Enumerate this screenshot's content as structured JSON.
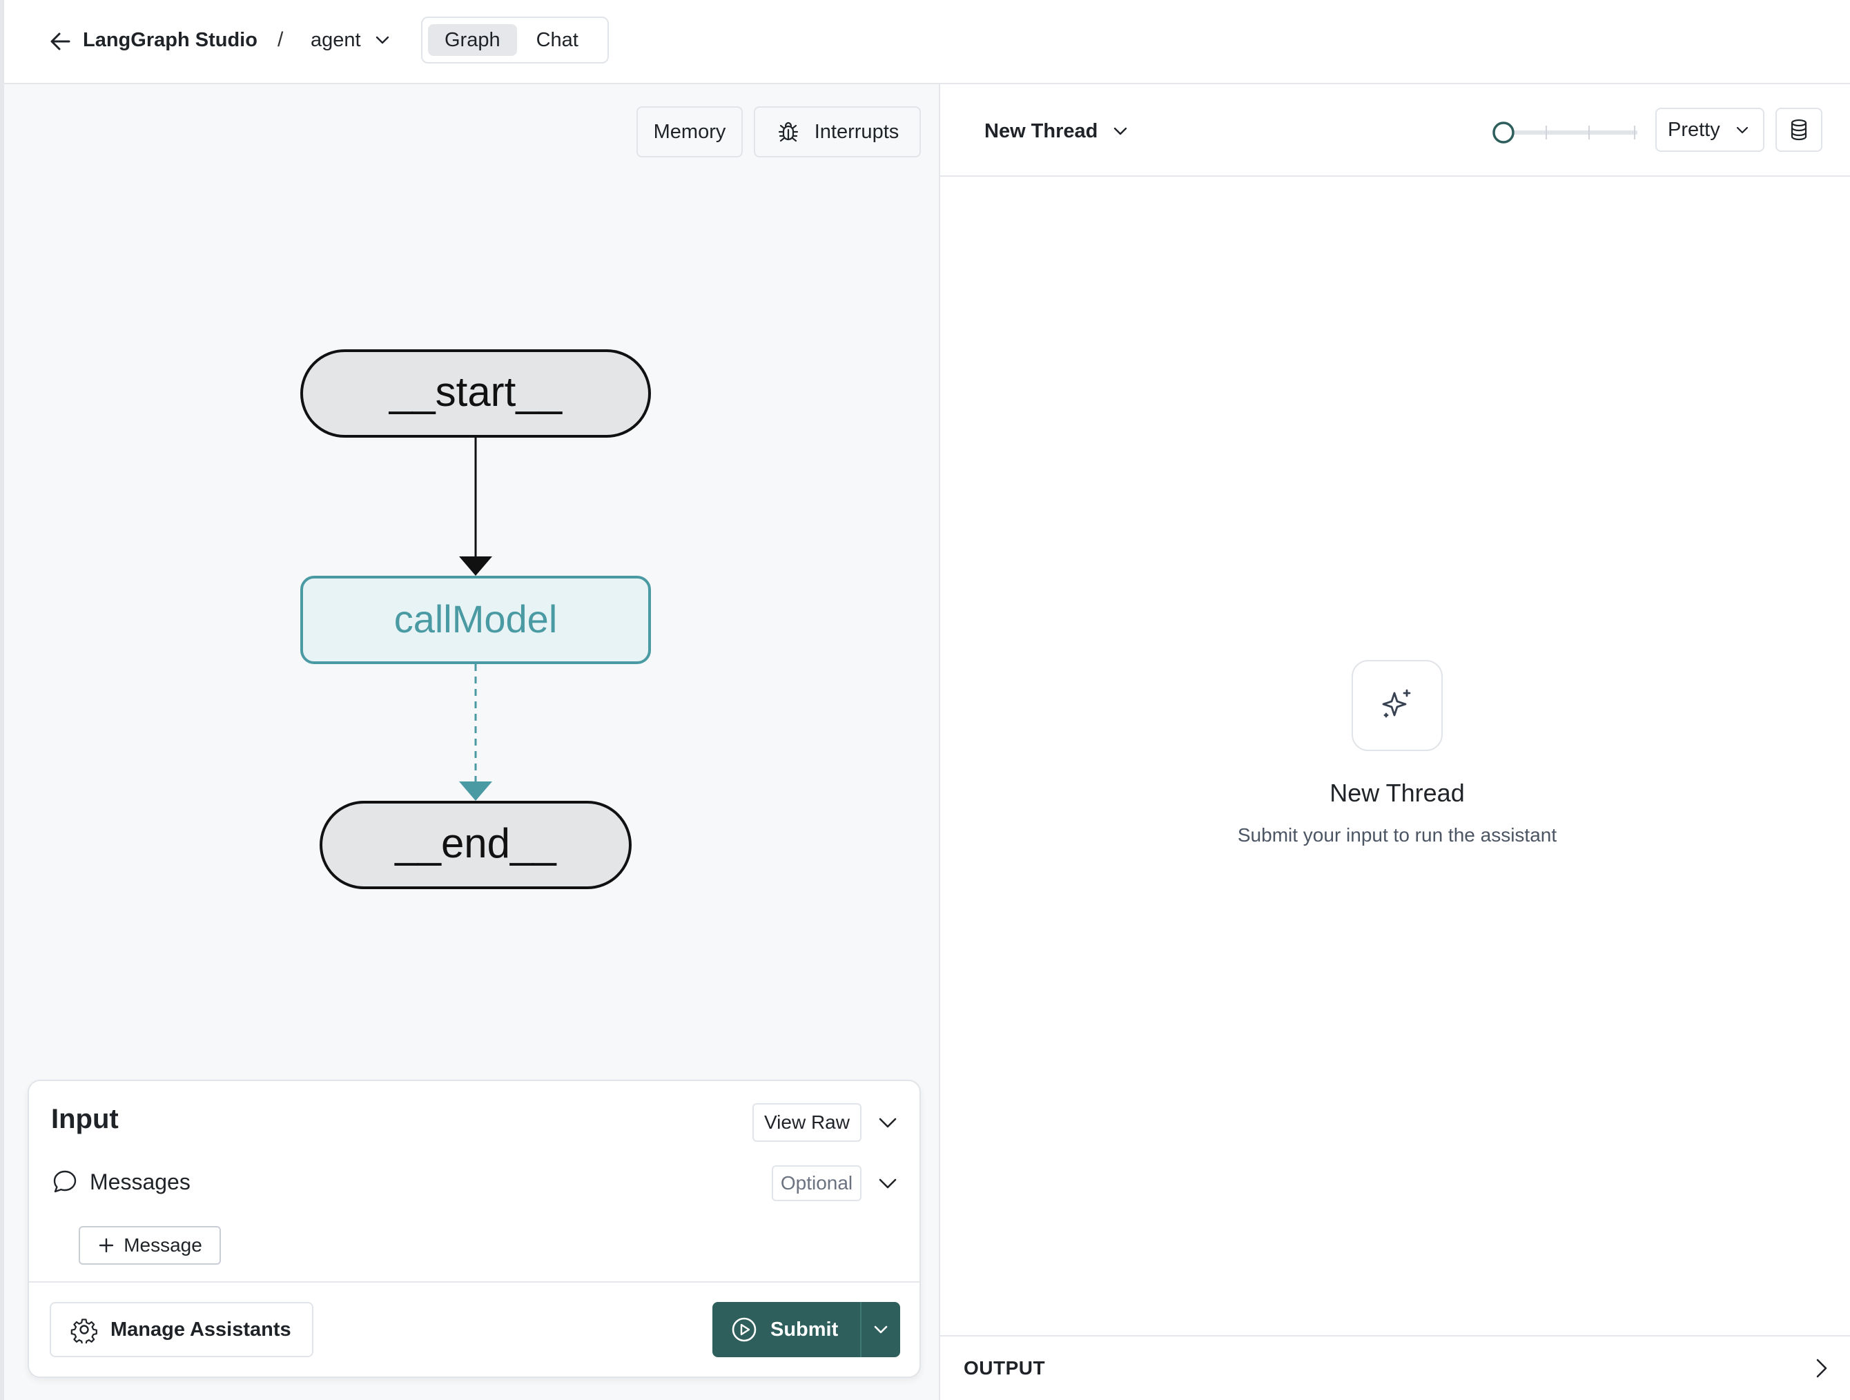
{
  "header": {
    "app_title": "LangGraph Studio",
    "breadcrumb_separator": "/",
    "graph_name": "agent",
    "tabs": [
      {
        "label": "Graph",
        "active": true
      },
      {
        "label": "Chat",
        "active": false
      }
    ]
  },
  "graph_panel": {
    "memory_label": "Memory",
    "interrupts_label": "Interrupts",
    "nodes": [
      {
        "id": "start",
        "label": "__start__"
      },
      {
        "id": "callModel",
        "label": "callModel"
      },
      {
        "id": "end",
        "label": "__end__"
      }
    ],
    "edges": [
      {
        "from": "start",
        "to": "callModel",
        "style": "solid"
      },
      {
        "from": "callModel",
        "to": "end",
        "style": "dashed"
      }
    ]
  },
  "input_card": {
    "title": "Input",
    "view_raw_label": "View Raw",
    "messages_label": "Messages",
    "optional_label": "Optional",
    "add_message_label": "Message",
    "manage_assistants_label": "Manage Assistants",
    "submit_label": "Submit"
  },
  "thread_panel": {
    "thread_name": "New Thread",
    "format_label": "Pretty",
    "empty_title": "New Thread",
    "empty_subtitle": "Submit your input to run the assistant",
    "output_label": "OUTPUT"
  },
  "colors": {
    "accent_teal": "#4a9aa3",
    "submit_bg": "#2f5f5c",
    "node_fill": "#e4e5e7",
    "active_node_fill": "#e8f3f5"
  }
}
